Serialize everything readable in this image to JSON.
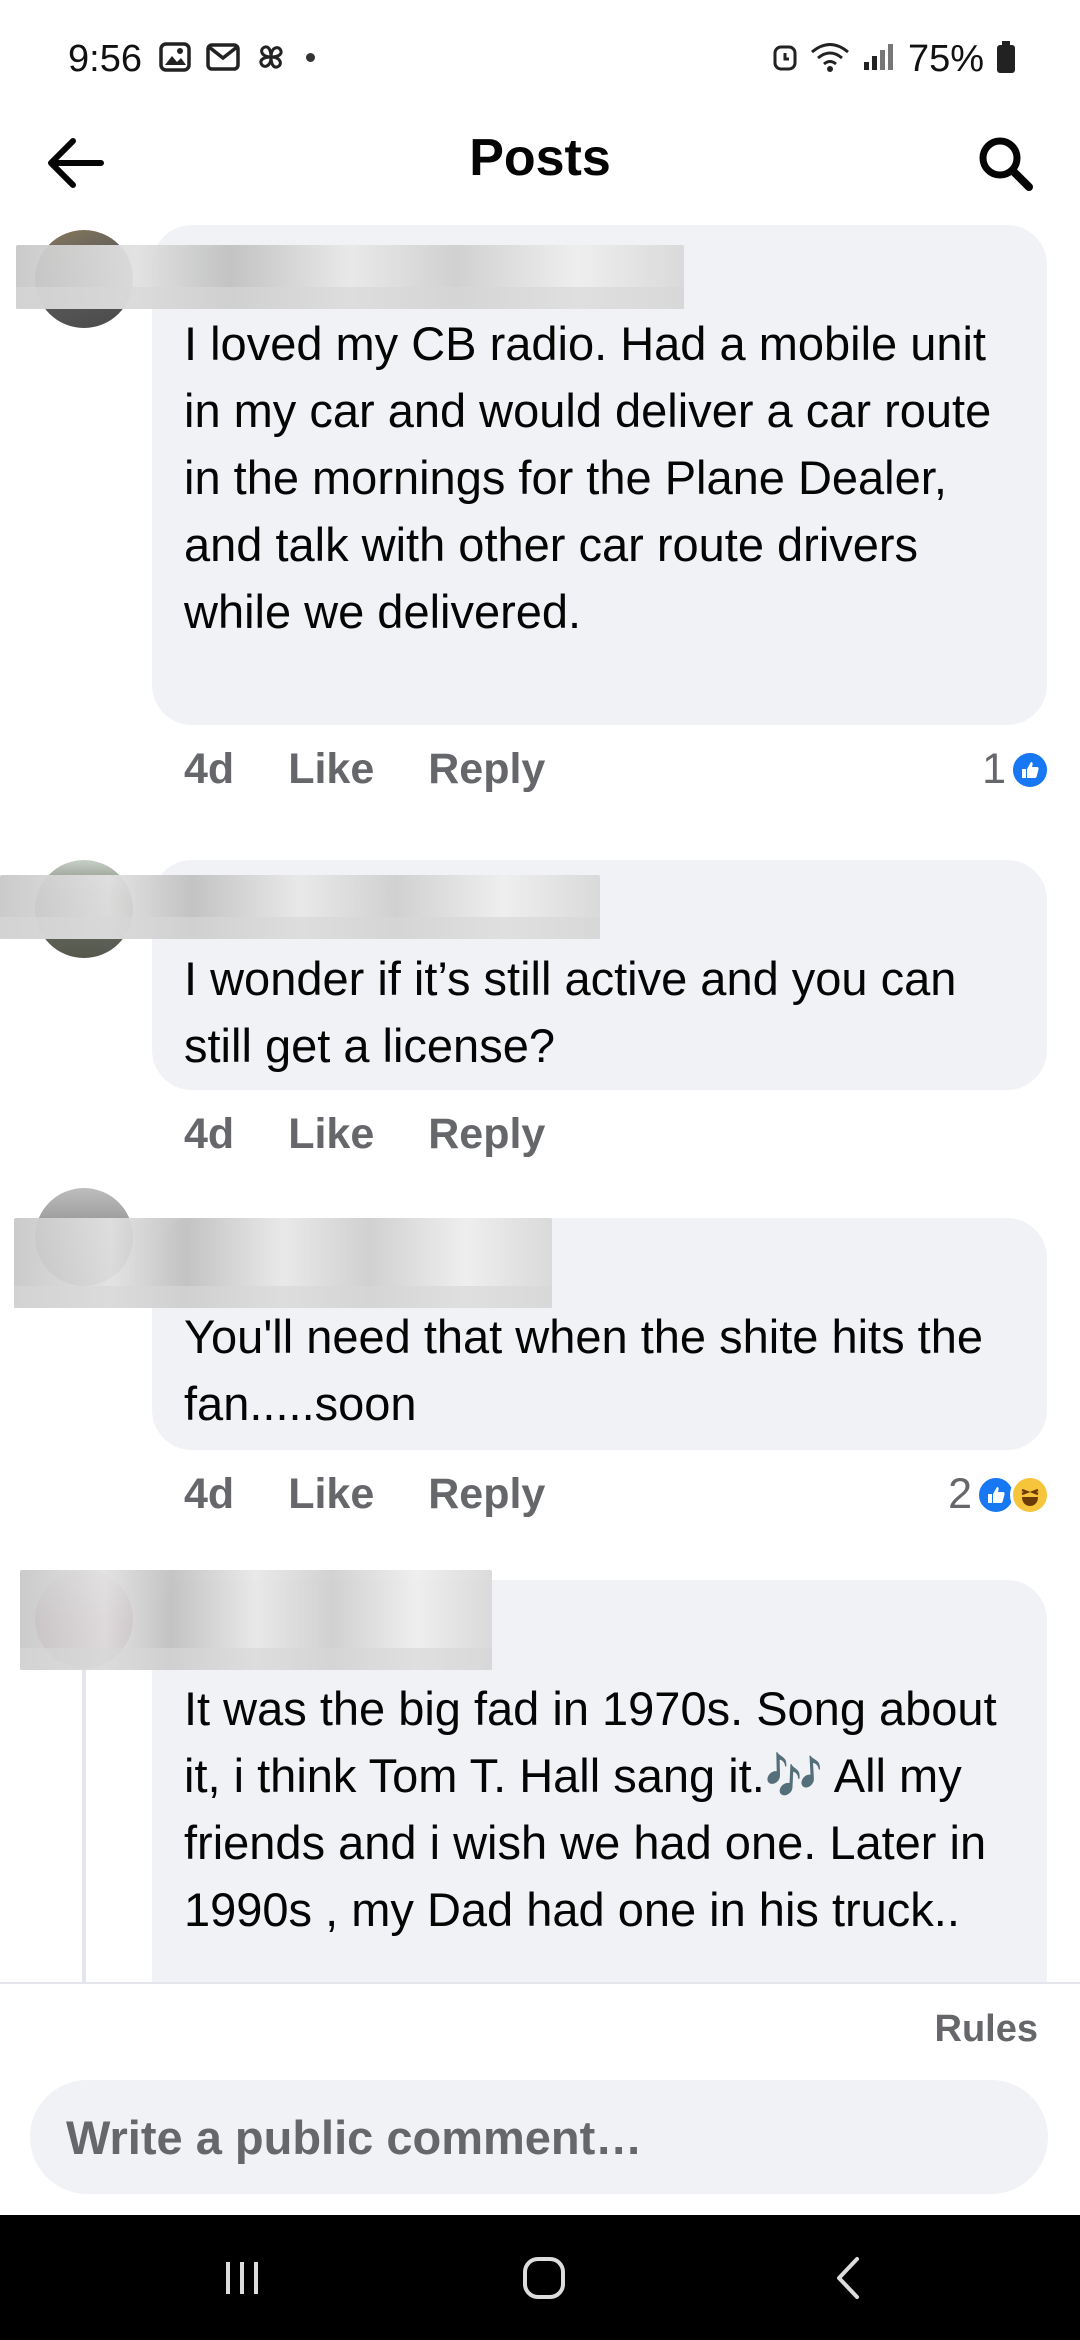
{
  "status_bar": {
    "time": "9:56",
    "battery": "75%"
  },
  "header": {
    "title": "Posts"
  },
  "comments": [
    {
      "text": "I loved my CB radio.  Had a mobile unit in my car and would deliver a car route in the mornings for the Plane Dealer, and talk with other car route drivers while we delivered.",
      "age": "4d",
      "like_label": "Like",
      "reply_label": "Reply",
      "reaction_count": "1"
    },
    {
      "text": "I wonder if it’s still active and you can still get a license?",
      "age": "4d",
      "like_label": "Like",
      "reply_label": "Reply"
    },
    {
      "text": "You'll need that when the shite hits the fan.....soon",
      "age": "4d",
      "like_label": "Like",
      "reply_label": "Reply",
      "reaction_count": "2"
    },
    {
      "text": "It was the big fad in 1970s. Song about it, i think Tom T. Hall sang it.🎶 All my friends and i wish we had one. Later in 1990s , my Dad had one in his truck.."
    }
  ],
  "footer": {
    "rules_label": "Rules",
    "comment_placeholder": "Write a public comment…"
  },
  "colors": {
    "accent": "#1877f2",
    "bubble": "#f0f2f5",
    "meta_text": "#65676b"
  }
}
